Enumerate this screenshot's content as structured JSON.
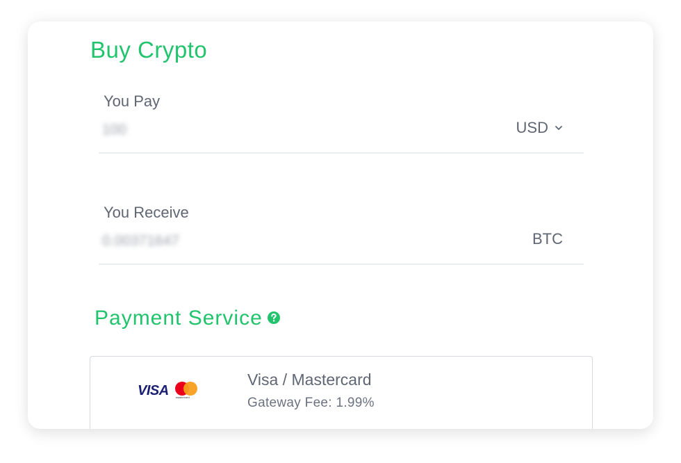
{
  "title": "Buy Crypto",
  "pay": {
    "label": "You Pay",
    "value": "100",
    "currency": "USD"
  },
  "receive": {
    "label": "You Receive",
    "value": "0.00371647",
    "currency": "BTC"
  },
  "payment_service": {
    "title": "Payment Service",
    "help_icon": "question-circle-icon",
    "options": [
      {
        "logo_visa": "VISA",
        "logo_mastercard": "mastercard",
        "name": "Visa / Mastercard",
        "fee": "Gateway Fee: 1.99%"
      }
    ]
  },
  "colors": {
    "accent": "#21c46d",
    "text": "#5f6673"
  }
}
